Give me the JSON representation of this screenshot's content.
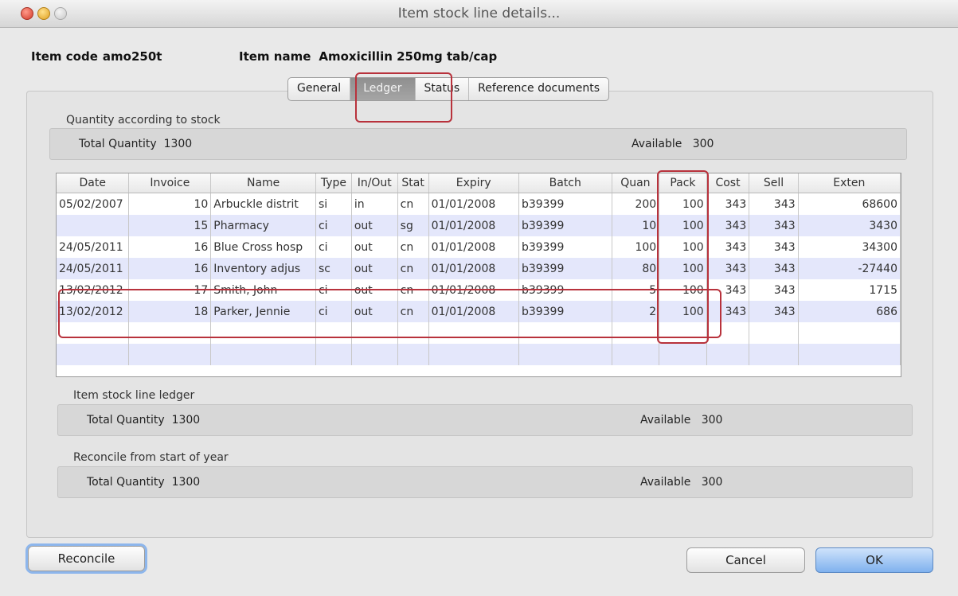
{
  "window": {
    "title": "Item stock line details..."
  },
  "header": {
    "item_code_label": "Item code",
    "item_code_value": "amo250t",
    "item_name_label": "Item name",
    "item_name_value": "Amoxicillin 250mg tab/cap"
  },
  "tabs": [
    {
      "label": "General",
      "active": false
    },
    {
      "label": "Ledger",
      "active": true
    },
    {
      "label": "Status",
      "active": false
    },
    {
      "label": "Reference documents",
      "active": false
    }
  ],
  "stock_quantity": {
    "label": "Quantity according to stock",
    "total_label": "Total Quantity",
    "total_value": "1300",
    "available_label": "Available",
    "available_value": "300"
  },
  "ledger": {
    "columns": [
      "Date",
      "Invoice",
      "Name",
      "Type",
      "In/Out",
      "Stat",
      "Expiry",
      "Batch",
      "Quan",
      "Pack",
      "Cost",
      "Sell",
      "Exten"
    ],
    "rows": [
      [
        "05/02/2007",
        "10",
        "Arbuckle distrit",
        "si",
        "in",
        "cn",
        "01/01/2008",
        "b39399",
        "200",
        "100",
        "343",
        "343",
        "68600"
      ],
      [
        "",
        "15",
        "Pharmacy",
        "ci",
        "out",
        "sg",
        "01/01/2008",
        "b39399",
        "10",
        "100",
        "343",
        "343",
        "3430"
      ],
      [
        "24/05/2011",
        "16",
        "Blue Cross hosp",
        "ci",
        "out",
        "cn",
        "01/01/2008",
        "b39399",
        "100",
        "100",
        "343",
        "343",
        "34300"
      ],
      [
        "24/05/2011",
        "16",
        "Inventory adjus",
        "sc",
        "out",
        "cn",
        "01/01/2008",
        "b39399",
        "80",
        "100",
        "343",
        "343",
        "-27440"
      ],
      [
        "13/02/2012",
        "17",
        "Smith, John",
        "ci",
        "out",
        "cn",
        "01/01/2008",
        "b39399",
        "5",
        "100",
        "343",
        "343",
        "1715"
      ],
      [
        "13/02/2012",
        "18",
        "Parker, Jennie",
        "ci",
        "out",
        "cn",
        "01/01/2008",
        "b39399",
        "2",
        "100",
        "343",
        "343",
        "686"
      ],
      [
        "",
        "",
        "",
        "",
        "",
        "",
        "",
        "",
        "",
        "",
        "",
        "",
        ""
      ],
      [
        "",
        "",
        "",
        "",
        "",
        "",
        "",
        "",
        "",
        "",
        "",
        "",
        ""
      ]
    ]
  },
  "stock_line_ledger": {
    "label": "Item stock line ledger",
    "total_label": "Total Quantity",
    "total_value": "1300",
    "available_label": "Available",
    "available_value": "300"
  },
  "reconcile_year": {
    "label": "Reconcile from start of year",
    "total_label": "Total Quantity",
    "total_value": "1300",
    "available_label": "Available",
    "available_value": "300"
  },
  "buttons": {
    "reconcile": "Reconcile",
    "cancel": "Cancel",
    "ok": "OK"
  },
  "colors": {
    "highlight_box": "#b8323c",
    "row_alt": "#e4e7fb",
    "default_button": "#7fb1ee"
  }
}
